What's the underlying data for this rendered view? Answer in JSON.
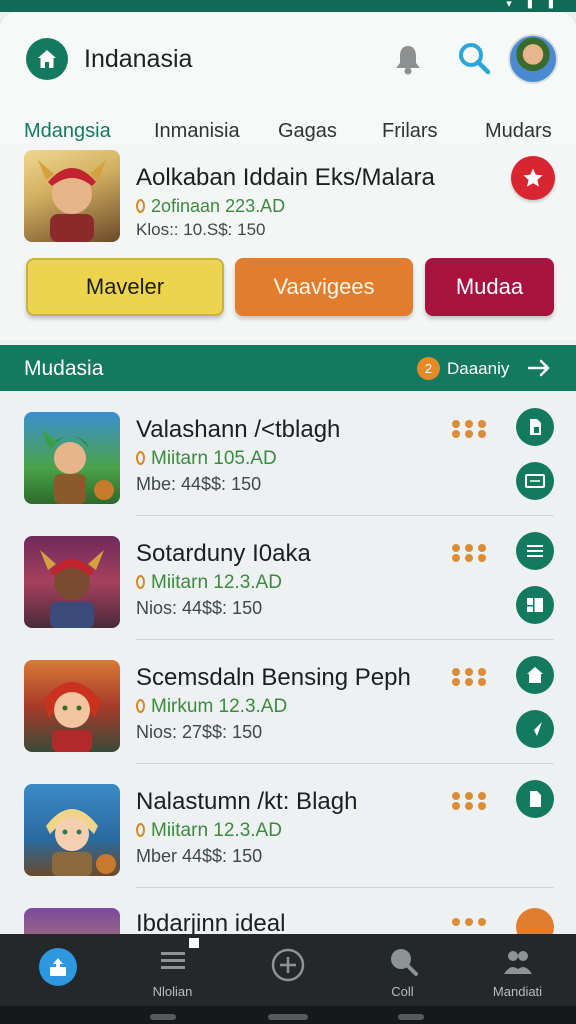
{
  "colors": {
    "brand": "#137a5f",
    "accent_red": "#d9252f",
    "accent_orange": "#e27d2e",
    "price_green": "#3b8a40",
    "nav_bg": "#24282a"
  },
  "header": {
    "title": "Indanasia",
    "icons": [
      "home-icon",
      "bell-icon",
      "search-icon",
      "avatar"
    ]
  },
  "tabs": [
    {
      "label": "Mdangsia",
      "active": true
    },
    {
      "label": "Inmanisia"
    },
    {
      "label": "Gagas"
    },
    {
      "label": "Frilars"
    },
    {
      "label": "Mudars"
    }
  ],
  "featured": {
    "title": "Aolkaban Iddain Eks/Malara",
    "subtitle": "2ofinaan 223.AD",
    "meta": "Klos:: 10.S$: 150",
    "buttons": [
      "Maveler",
      "Vaavigees",
      "Mudaa"
    ]
  },
  "section": {
    "title": "Mudasia",
    "badge": "2",
    "link": "Daaaniy"
  },
  "list": [
    {
      "title": "Valashann /<tblagh",
      "subtitle": "Miitarn 105.AD",
      "meta": "Mbe: 44$$: 150"
    },
    {
      "title": "Sotarduny I0aka",
      "subtitle": "Miitarn 12.3.AD",
      "meta": "Nios: 44$$: 150"
    },
    {
      "title": "Scemsdaln Bensing Peph",
      "subtitle": "Mirkum 12.3.AD",
      "meta": "Nios: 27$$: 150"
    },
    {
      "title": "Nalastumn /kt: Blagh",
      "subtitle": "Miitarn 12.3.AD",
      "meta": "Mber 44$$: 150"
    },
    {
      "title": "Ibdarjinn ideal",
      "subtitle": "",
      "meta": ""
    }
  ],
  "bottom_nav": [
    {
      "label": "",
      "icon": "share-icon",
      "active": true
    },
    {
      "label": "Nlolian",
      "icon": "list-icon"
    },
    {
      "label": "",
      "icon": "plus-circle-icon"
    },
    {
      "label": "Coll",
      "icon": "search-icon"
    },
    {
      "label": "Mandiati",
      "icon": "people-icon"
    }
  ]
}
